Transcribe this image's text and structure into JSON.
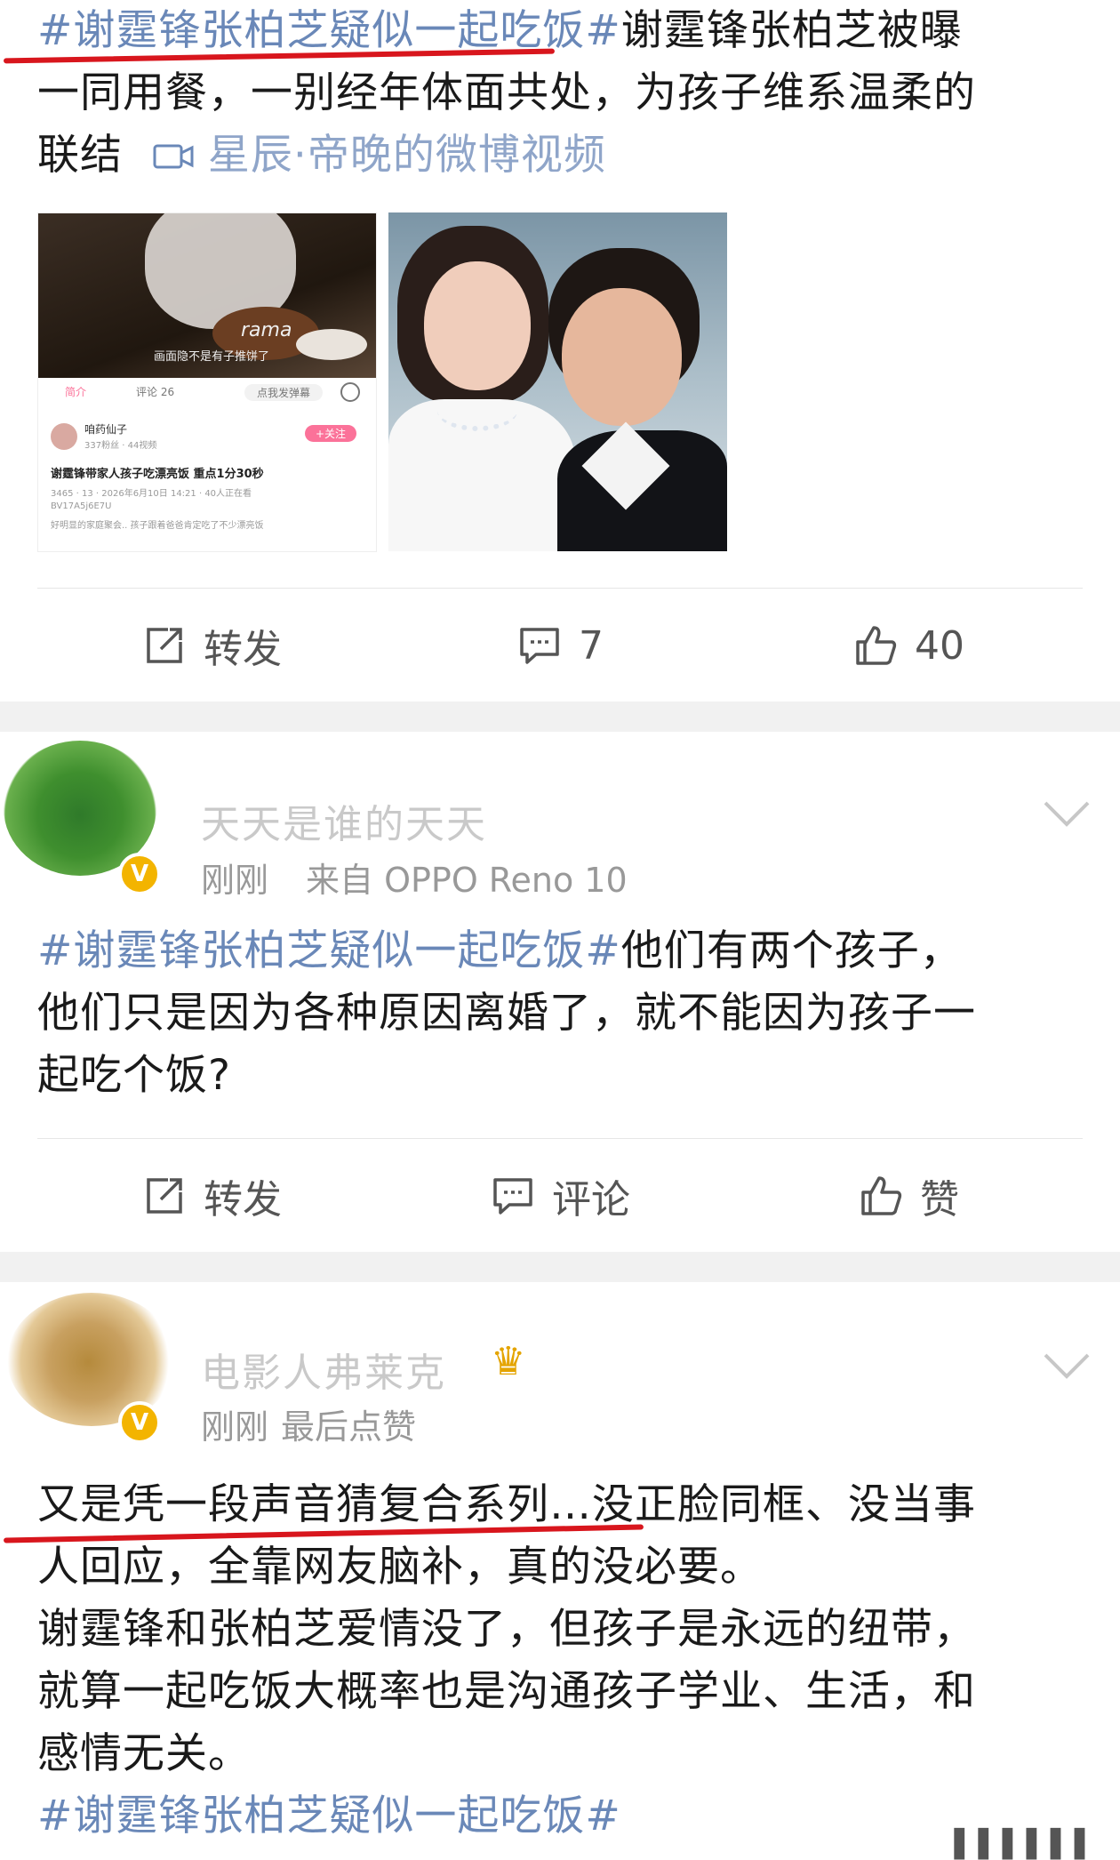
{
  "post1": {
    "hashtag": "#谢霆锋张柏芝疑似一起吃饭#",
    "text_line1_rest": "谢霆锋张柏芝被曝",
    "text_line2": "一同用餐，一别经年体面共处，为孩子维系温柔的",
    "text_line3": "联结",
    "video_link": "星辰·帝晚的微博视频",
    "image1": {
      "overlay_text": "画面隐不是有子推饼了",
      "cake_text": "rama",
      "tab_intro": "简介",
      "tab_comments": "评论 26",
      "danmaku_btn": "点我发弹幕",
      "username": "咱药仙子",
      "follow_label": "+关注",
      "fans_meta": "337粉丝 · 44视频",
      "title": "谢霆锋带家人孩子吃漂亮饭 重点1分30秒",
      "stats": "3465 · 13 · 2026年6月10日 14:21 · 40人正在看",
      "bvid": "BV17A5j6E7U",
      "desc": "好明显的家庭聚会.. 孩子跟着爸爸肯定吃了不少漂亮饭"
    },
    "actions": {
      "repost": "转发",
      "comment": "7",
      "like": "40"
    }
  },
  "comment1": {
    "username": "天天是谁的天天",
    "time": "刚刚",
    "source": "来自 OPPO Reno 10",
    "hashtag": "#谢霆锋张柏芝疑似一起吃饭#",
    "line1_rest": "他们有两个孩子，",
    "line2": "他们只是因为各种原因离婚了，就不能因为孩子一",
    "line3": "起吃个饭?",
    "actions": {
      "repost": "转发",
      "comment": "评论",
      "like": "赞"
    }
  },
  "comment2": {
    "username": "电影人弗莱克",
    "time": "刚刚",
    "meta": "最后点赞",
    "line1": "又是凭一段声音猜复合系列…没正脸同框、没当事",
    "line2": "人回应，全靠网友脑补，真的没必要。",
    "line3": "谢霆锋和张柏芝爱情没了，但孩子是永远的纽带，",
    "line4": "就算一起吃饭大概率也是沟通孩子学业、生活，和",
    "line5": "感情无关。",
    "hashtag": "#谢霆锋张柏芝疑似一起吃饭#"
  },
  "watermark": "▌▌▌▌▌▌",
  "colors": {
    "link": "#6a88b8",
    "annotation": "#d8161d",
    "badge": "#f3b400",
    "divider": "#f1f1f1"
  }
}
